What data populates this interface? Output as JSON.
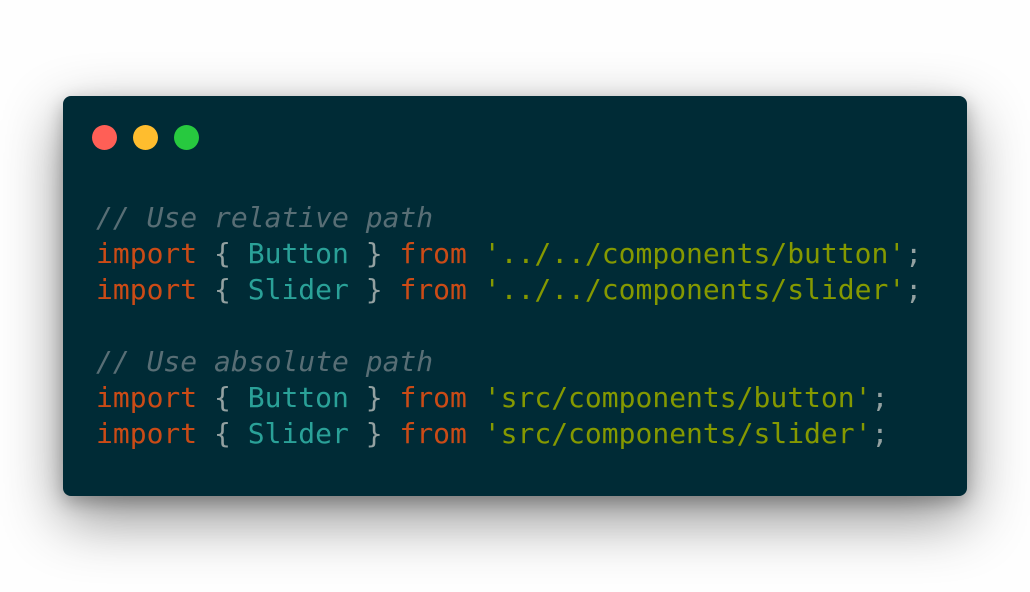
{
  "window": {
    "buttons": [
      {
        "name": "close",
        "color": "#ff5f56"
      },
      {
        "name": "minimize",
        "color": "#ffbd2e"
      },
      {
        "name": "zoom",
        "color": "#27c93f"
      }
    ]
  },
  "code": {
    "lines": [
      {
        "type": "comment",
        "text": "// Use relative path"
      },
      {
        "type": "import",
        "keyword": "import",
        "open_brace": "{",
        "name": "Button",
        "close_brace": "}",
        "from": "from",
        "path": "'../../components/button'",
        "semicolon": ";"
      },
      {
        "type": "import",
        "keyword": "import",
        "open_brace": "{",
        "name": "Slider",
        "close_brace": "}",
        "from": "from",
        "path": "'../../components/slider'",
        "semicolon": ";"
      },
      {
        "type": "blank"
      },
      {
        "type": "comment",
        "text": "// Use absolute path"
      },
      {
        "type": "import",
        "keyword": "import",
        "open_brace": "{",
        "name": "Button",
        "close_brace": "}",
        "from": "from",
        "path": "'src/components/button'",
        "semicolon": ";"
      },
      {
        "type": "import",
        "keyword": "import",
        "open_brace": "{",
        "name": "Slider",
        "close_brace": "}",
        "from": "from",
        "path": "'src/components/slider'",
        "semicolon": ";"
      }
    ]
  },
  "colors": {
    "background": "#002b36",
    "comment": "#586e75",
    "keyword": "#cb4b16",
    "identifier": "#2aa198",
    "string": "#859900",
    "punctuation": "#93a1a1"
  }
}
